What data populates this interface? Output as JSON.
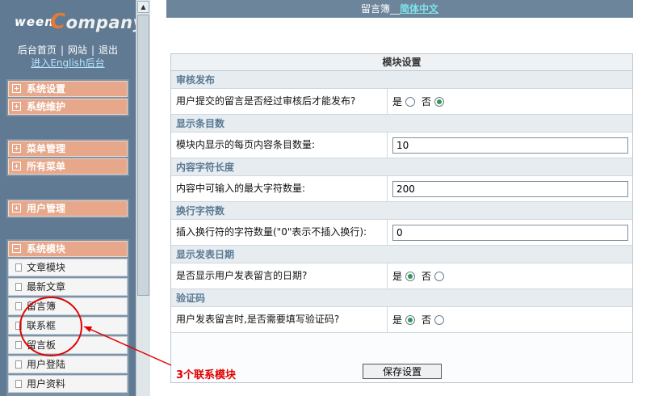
{
  "sidebar": {
    "logo_prefix": "ween",
    "logo_word": "Company",
    "links": [
      "后台首页",
      "网站",
      "退出"
    ],
    "english_link": "进入English后台",
    "groups": [
      [
        "系统设置",
        "系统维护"
      ],
      [
        "菜单管理",
        "所有菜单"
      ],
      [
        "用户管理"
      ]
    ],
    "module_head": "系统模块",
    "module_items": [
      "文章模块",
      "最新文章",
      "留言簿",
      "联系框",
      "留言板",
      "用户登陆",
      "用户资料"
    ]
  },
  "header": {
    "title_prefix": "留言簿__",
    "language": "简体中文"
  },
  "form": {
    "title": "模块设置",
    "yes": "是",
    "no": "否",
    "sections": [
      {
        "title": "审核发布",
        "label": "用户提交的留言是否经过审核后才能发布?",
        "type": "radio",
        "selected": "no"
      },
      {
        "title": "显示条目数",
        "label": "模块内显示的每页内容条目数量:",
        "type": "text",
        "value": "10"
      },
      {
        "title": "内容字符长度",
        "label": "内容中可输入的最大字符数量:",
        "type": "text",
        "value": "200"
      },
      {
        "title": "换行字符数",
        "label": "插入换行符的字符数量(\"0\"表示不插入换行):",
        "type": "text",
        "value": "0"
      },
      {
        "title": "显示发表日期",
        "label": "是否显示用户发表留言的日期?",
        "type": "radio",
        "selected": "yes"
      },
      {
        "title": "验证码",
        "label": "用户发表留言时,是否需要填写验证码?",
        "type": "radio",
        "selected": "yes"
      }
    ],
    "save_label": "保存设置"
  },
  "annotation": {
    "text": "3个联系模块",
    "color": "#e00000"
  }
}
